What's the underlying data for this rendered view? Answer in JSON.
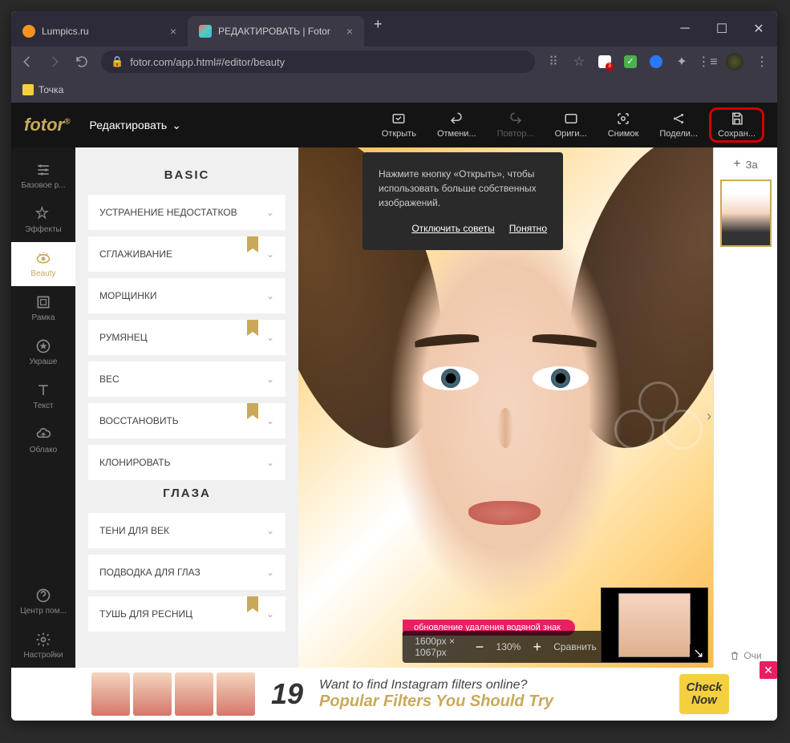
{
  "browser": {
    "tabs": [
      {
        "title": "Lumpics.ru"
      },
      {
        "title": "РЕДАКТИРОВАТЬ | Fotor"
      }
    ],
    "url": "fotor.com/app.html#/editor/beauty",
    "bookmark": "Точка"
  },
  "header": {
    "logo": "fotor",
    "mode": "Редактировать",
    "tools": {
      "open": "Открыть",
      "undo": "Отмени...",
      "redo": "Повтор...",
      "original": "Ориги...",
      "snapshot": "Снимок",
      "share": "Подели...",
      "save": "Сохран..."
    }
  },
  "sidebar": {
    "items": [
      {
        "label": "Базовое р..."
      },
      {
        "label": "Эффекты"
      },
      {
        "label": "Beauty"
      },
      {
        "label": "Рамка"
      },
      {
        "label": "Украше"
      },
      {
        "label": "Текст"
      },
      {
        "label": "Облако"
      }
    ],
    "bottom": [
      {
        "label": "Центр пом..."
      },
      {
        "label": "Настройки"
      }
    ]
  },
  "panel": {
    "section1": "BASIC",
    "items1": [
      {
        "label": "УСТРАНЕНИЕ НЕДОСТАТКОВ",
        "badge": false
      },
      {
        "label": "СГЛАЖИВАНИЕ",
        "badge": true
      },
      {
        "label": "МОРЩИНКИ",
        "badge": false
      },
      {
        "label": "РУМЯНЕЦ",
        "badge": true
      },
      {
        "label": "ВЕС",
        "badge": false
      },
      {
        "label": "ВОССТАНОВИТЬ",
        "badge": true
      },
      {
        "label": "КЛОНИРОВАТЬ",
        "badge": false
      }
    ],
    "section2": "ГЛАЗА",
    "items2": [
      {
        "label": "ТЕНИ ДЛЯ ВЕК",
        "badge": false
      },
      {
        "label": "ПОДВОДКА ДЛЯ ГЛАЗ",
        "badge": false
      },
      {
        "label": "ТУШЬ ДЛЯ РЕСНИЦ",
        "badge": true
      }
    ]
  },
  "tooltip": {
    "text": "Нажмите кнопку «Открыть», чтобы использовать больше собственных изображений.",
    "disable": "Отключить советы",
    "ok": "Понятно"
  },
  "canvas": {
    "dimensions": "1600px × 1067px",
    "zoom": "130%",
    "compare": "Сравнить",
    "banner": "обновление удаления водяной знак"
  },
  "right": {
    "upload": "За",
    "clear": "Очи"
  },
  "ad": {
    "number": "19",
    "line1": "Want to find Instagram filters online?",
    "line2": "Popular Filters You Should Try",
    "cta1": "Check",
    "cta2": "Now"
  }
}
